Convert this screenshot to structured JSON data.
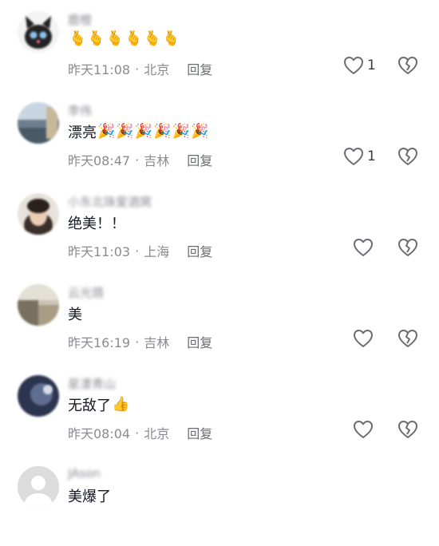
{
  "comments": [
    {
      "username": "鹿橙",
      "text": "",
      "emojis": [
        "🫰",
        "🫰",
        "🫰",
        "🫰",
        "🫰",
        "🫰"
      ],
      "time": "昨天11:08",
      "location": "北京",
      "reply_label": "回复",
      "like_count": "1",
      "avatar": "cat-avatar"
    },
    {
      "username": "李伟",
      "text": "漂亮",
      "emojis": [
        "🎉",
        "🎉",
        "🎉",
        "🎉",
        "🎉",
        "🎉"
      ],
      "time": "昨天08:47",
      "location": "吉林",
      "reply_label": "回复",
      "like_count": "1",
      "avatar": "lake-avatar"
    },
    {
      "username": "小东北珠爱酒窝",
      "text": "绝美！！",
      "emojis": [],
      "time": "昨天11:03",
      "location": "上海",
      "reply_label": "回复",
      "like_count": "",
      "avatar": "portrait-avatar"
    },
    {
      "username": "云光荫",
      "text": "美",
      "emojis": [],
      "time": "昨天16:19",
      "location": "吉林",
      "reply_label": "回复",
      "like_count": "",
      "avatar": "landscape-avatar"
    },
    {
      "username": "星漾青山",
      "text": "无敌了",
      "emojis": [
        "👍"
      ],
      "time": "昨天08:04",
      "location": "北京",
      "reply_label": "回复",
      "like_count": "",
      "avatar": "dark-avatar"
    },
    {
      "username": "JAson",
      "text": "美爆了",
      "emojis": [],
      "time": "",
      "location": "",
      "reply_label": "",
      "like_count": "",
      "avatar": "default-avatar"
    }
  ],
  "icons": {
    "like": "heart-icon",
    "dislike": "broken-heart-icon"
  },
  "colors": {
    "text": "#161823",
    "meta": "#8a8b91",
    "icon": "#6b6c72"
  }
}
